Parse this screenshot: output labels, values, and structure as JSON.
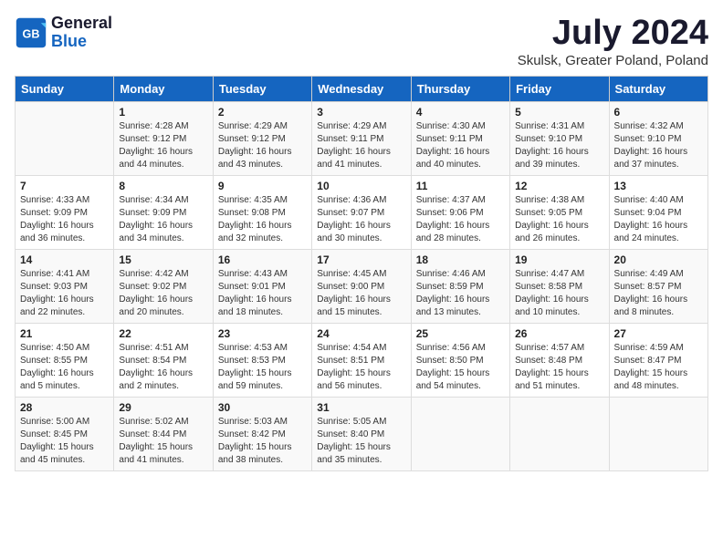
{
  "header": {
    "logo_line1": "General",
    "logo_line2": "Blue",
    "month": "July 2024",
    "location": "Skulsk, Greater Poland, Poland"
  },
  "days_of_week": [
    "Sunday",
    "Monday",
    "Tuesday",
    "Wednesday",
    "Thursday",
    "Friday",
    "Saturday"
  ],
  "weeks": [
    [
      {
        "day": "",
        "detail": ""
      },
      {
        "day": "1",
        "detail": "Sunrise: 4:28 AM\nSunset: 9:12 PM\nDaylight: 16 hours and 44 minutes."
      },
      {
        "day": "2",
        "detail": "Sunrise: 4:29 AM\nSunset: 9:12 PM\nDaylight: 16 hours and 43 minutes."
      },
      {
        "day": "3",
        "detail": "Sunrise: 4:29 AM\nSunset: 9:11 PM\nDaylight: 16 hours and 41 minutes."
      },
      {
        "day": "4",
        "detail": "Sunrise: 4:30 AM\nSunset: 9:11 PM\nDaylight: 16 hours and 40 minutes."
      },
      {
        "day": "5",
        "detail": "Sunrise: 4:31 AM\nSunset: 9:10 PM\nDaylight: 16 hours and 39 minutes."
      },
      {
        "day": "6",
        "detail": "Sunrise: 4:32 AM\nSunset: 9:10 PM\nDaylight: 16 hours and 37 minutes."
      }
    ],
    [
      {
        "day": "7",
        "detail": "Sunrise: 4:33 AM\nSunset: 9:09 PM\nDaylight: 16 hours and 36 minutes."
      },
      {
        "day": "8",
        "detail": "Sunrise: 4:34 AM\nSunset: 9:09 PM\nDaylight: 16 hours and 34 minutes."
      },
      {
        "day": "9",
        "detail": "Sunrise: 4:35 AM\nSunset: 9:08 PM\nDaylight: 16 hours and 32 minutes."
      },
      {
        "day": "10",
        "detail": "Sunrise: 4:36 AM\nSunset: 9:07 PM\nDaylight: 16 hours and 30 minutes."
      },
      {
        "day": "11",
        "detail": "Sunrise: 4:37 AM\nSunset: 9:06 PM\nDaylight: 16 hours and 28 minutes."
      },
      {
        "day": "12",
        "detail": "Sunrise: 4:38 AM\nSunset: 9:05 PM\nDaylight: 16 hours and 26 minutes."
      },
      {
        "day": "13",
        "detail": "Sunrise: 4:40 AM\nSunset: 9:04 PM\nDaylight: 16 hours and 24 minutes."
      }
    ],
    [
      {
        "day": "14",
        "detail": "Sunrise: 4:41 AM\nSunset: 9:03 PM\nDaylight: 16 hours and 22 minutes."
      },
      {
        "day": "15",
        "detail": "Sunrise: 4:42 AM\nSunset: 9:02 PM\nDaylight: 16 hours and 20 minutes."
      },
      {
        "day": "16",
        "detail": "Sunrise: 4:43 AM\nSunset: 9:01 PM\nDaylight: 16 hours and 18 minutes."
      },
      {
        "day": "17",
        "detail": "Sunrise: 4:45 AM\nSunset: 9:00 PM\nDaylight: 16 hours and 15 minutes."
      },
      {
        "day": "18",
        "detail": "Sunrise: 4:46 AM\nSunset: 8:59 PM\nDaylight: 16 hours and 13 minutes."
      },
      {
        "day": "19",
        "detail": "Sunrise: 4:47 AM\nSunset: 8:58 PM\nDaylight: 16 hours and 10 minutes."
      },
      {
        "day": "20",
        "detail": "Sunrise: 4:49 AM\nSunset: 8:57 PM\nDaylight: 16 hours and 8 minutes."
      }
    ],
    [
      {
        "day": "21",
        "detail": "Sunrise: 4:50 AM\nSunset: 8:55 PM\nDaylight: 16 hours and 5 minutes."
      },
      {
        "day": "22",
        "detail": "Sunrise: 4:51 AM\nSunset: 8:54 PM\nDaylight: 16 hours and 2 minutes."
      },
      {
        "day": "23",
        "detail": "Sunrise: 4:53 AM\nSunset: 8:53 PM\nDaylight: 15 hours and 59 minutes."
      },
      {
        "day": "24",
        "detail": "Sunrise: 4:54 AM\nSunset: 8:51 PM\nDaylight: 15 hours and 56 minutes."
      },
      {
        "day": "25",
        "detail": "Sunrise: 4:56 AM\nSunset: 8:50 PM\nDaylight: 15 hours and 54 minutes."
      },
      {
        "day": "26",
        "detail": "Sunrise: 4:57 AM\nSunset: 8:48 PM\nDaylight: 15 hours and 51 minutes."
      },
      {
        "day": "27",
        "detail": "Sunrise: 4:59 AM\nSunset: 8:47 PM\nDaylight: 15 hours and 48 minutes."
      }
    ],
    [
      {
        "day": "28",
        "detail": "Sunrise: 5:00 AM\nSunset: 8:45 PM\nDaylight: 15 hours and 45 minutes."
      },
      {
        "day": "29",
        "detail": "Sunrise: 5:02 AM\nSunset: 8:44 PM\nDaylight: 15 hours and 41 minutes."
      },
      {
        "day": "30",
        "detail": "Sunrise: 5:03 AM\nSunset: 8:42 PM\nDaylight: 15 hours and 38 minutes."
      },
      {
        "day": "31",
        "detail": "Sunrise: 5:05 AM\nSunset: 8:40 PM\nDaylight: 15 hours and 35 minutes."
      },
      {
        "day": "",
        "detail": ""
      },
      {
        "day": "",
        "detail": ""
      },
      {
        "day": "",
        "detail": ""
      }
    ]
  ]
}
